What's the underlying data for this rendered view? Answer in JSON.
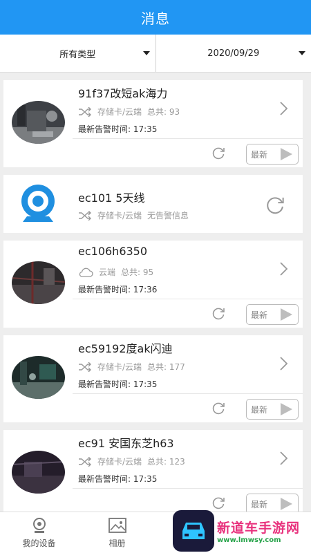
{
  "header": {
    "title": "消息"
  },
  "filters": {
    "type": "所有类型",
    "date": "2020/09/29"
  },
  "cards": [
    {
      "name": "91f37改短ak海力",
      "storage_icon": "shuffle-icon",
      "storage": "存储卡/云端",
      "total": "总共: 93",
      "alarm": "最新告警时间: 17:35",
      "latest": "最新"
    },
    {
      "name": "ec101 5天线",
      "storage_icon": "shuffle-icon",
      "storage": "存储卡/云端",
      "status": "无告警信息"
    },
    {
      "name": "ec106h6350",
      "storage_icon": "cloud-icon",
      "storage": "云端",
      "total": "总共: 95",
      "alarm": "最新告警时间: 17:36",
      "latest": "最新"
    },
    {
      "name": "ec59192度ak闪迪",
      "storage_icon": "shuffle-icon",
      "storage": "存储卡/云端",
      "total": "总共: 177",
      "alarm": "最新告警时间: 17:35",
      "latest": "最新"
    },
    {
      "name": "ec91 安国东芝h63",
      "storage_icon": "shuffle-icon",
      "storage": "存储卡/云端",
      "total": "总共: 123",
      "alarm": "最新告警时间: 17:35",
      "latest": "最新"
    }
  ],
  "bottom_nav": [
    {
      "label": "我的设备",
      "icon": "device-icon"
    },
    {
      "label": "相册",
      "icon": "album-icon"
    }
  ],
  "watermark": {
    "text": "新道车手游网",
    "url": "www.lmwsy.com"
  },
  "colors": {
    "primary": "#2196f3",
    "watermark_text": "#e8327d",
    "watermark_url": "#27a34a"
  }
}
